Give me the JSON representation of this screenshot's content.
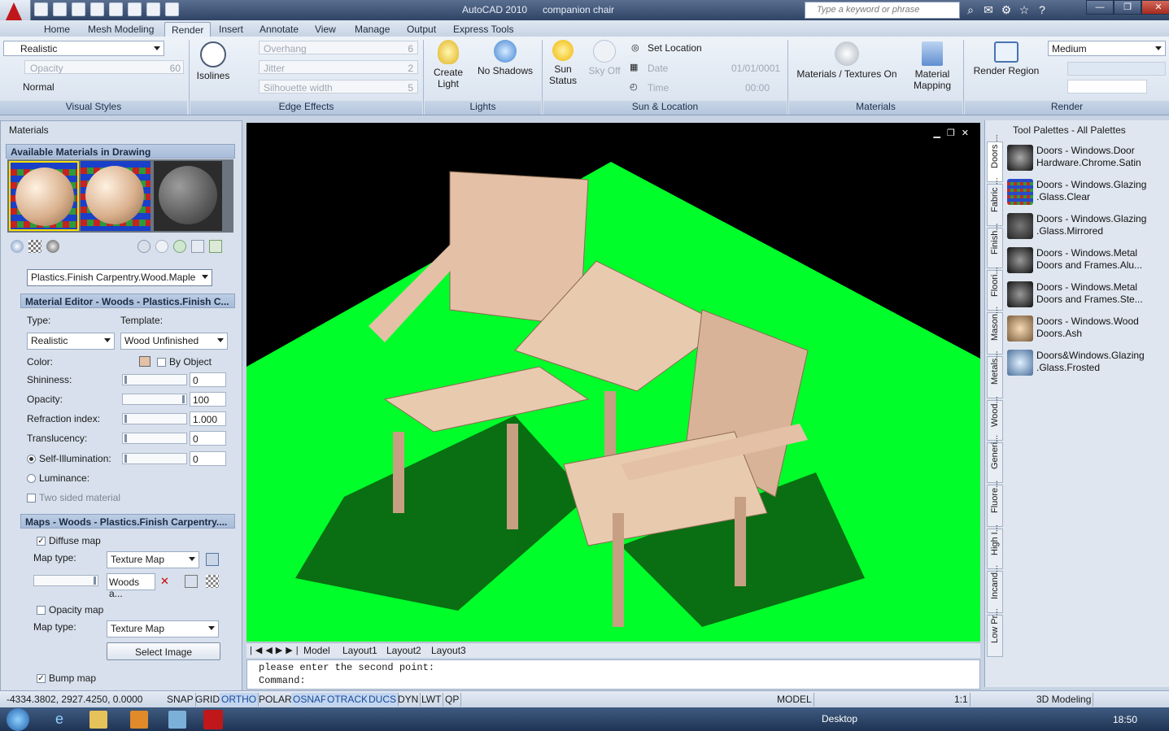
{
  "window": {
    "title": "AutoCAD 2010",
    "document": "companion chair",
    "search_placeholder": "Type a keyword or phrase"
  },
  "ribbon_tabs": [
    "Home",
    "Mesh Modeling",
    "Render",
    "Insert",
    "Annotate",
    "View",
    "Manage",
    "Output",
    "Express Tools"
  ],
  "active_tab": "Render",
  "visual_styles": {
    "style": "Realistic",
    "opacity_label": "Opacity",
    "opacity_value": "60",
    "face_style": "Normal",
    "title": "Visual Styles"
  },
  "edge_effects": {
    "isolines": "Isolines",
    "overhang": "Overhang",
    "overhang_val": "6",
    "jitter": "Jitter",
    "jitter_val": "2",
    "silhouette": "Silhouette width",
    "silhouette_val": "5",
    "title": "Edge Effects"
  },
  "lights": {
    "create_light": "Create",
    "create_light2": "Light",
    "no_shadows": "No Shadows",
    "title": "Lights"
  },
  "sun": {
    "sun_status": "Sun",
    "sun_status2": "Status",
    "sky_off": "Sky Off",
    "set_location": "Set Location",
    "date_label": "Date",
    "date_val": "01/01/0001",
    "time_label": "Time",
    "time_val": "00:00",
    "title": "Sun & Location"
  },
  "materials": {
    "textures": "Materials / Textures On",
    "mapping": "Material",
    "mapping2": "Mapping",
    "title": "Materials"
  },
  "render": {
    "region": "Render Region",
    "quality": "Medium",
    "title": "Render"
  },
  "left_palette": {
    "title": "Materials",
    "available": "Available Materials in Drawing",
    "material_name": "Plastics.Finish Carpentry.Wood.Maple",
    "editor_title": "Material Editor - Woods - Plastics.Finish C...",
    "type_label": "Type:",
    "template_label": "Template:",
    "type_val": "Realistic",
    "template_val": "Wood Unfinished",
    "color_label": "Color:",
    "by_object": "By Object",
    "shininess": "Shininess:",
    "shininess_val": "0",
    "opacity": "Opacity:",
    "opacity_val": "100",
    "refraction": "Refraction index:",
    "refraction_val": "1.000",
    "translucency": "Translucency:",
    "translucency_val": "0",
    "self_illum": "Self-Illumination:",
    "self_illum_val": "0",
    "luminance": "Luminance:",
    "two_sided": "Two sided material",
    "maps_title": "Maps - Woods - Plastics.Finish Carpentry....",
    "diffuse_map": "Diffuse map",
    "map_type": "Map type:",
    "texture_map": "Texture Map",
    "woods_btn": "Woods a...",
    "opacity_map": "Opacity map",
    "select_image": "Select Image",
    "bump_map": "Bump map"
  },
  "tool_palette": {
    "title": "Tool Palettes - All Palettes",
    "tabs": [
      "Doors ...",
      "Fabric ...",
      "Finish...",
      "Floori...",
      "Mason...",
      "Metals...",
      "Wood...",
      "Generi...",
      "Fluore...",
      "High I...",
      "Incand...",
      "Low Pr..."
    ],
    "items": [
      {
        "l1": "Doors - Windows.Door",
        "l2": "Hardware.Chrome.Satin"
      },
      {
        "l1": "Doors - Windows.Glazing",
        "l2": ".Glass.Clear"
      },
      {
        "l1": "Doors - Windows.Glazing",
        "l2": ".Glass.Mirrored"
      },
      {
        "l1": "Doors - Windows.Metal",
        "l2": "Doors and Frames.Alu..."
      },
      {
        "l1": "Doors - Windows.Metal",
        "l2": "Doors and Frames.Ste..."
      },
      {
        "l1": "Doors - Windows.Wood",
        "l2": "Doors.Ash"
      },
      {
        "l1": "Doors&Windows.Glazing",
        "l2": ".Glass.Frosted"
      }
    ]
  },
  "layout_tabs": [
    "Model",
    "Layout1",
    "Layout2",
    "Layout3"
  ],
  "command": {
    "line1": "please enter the second point:",
    "line2": "Command:"
  },
  "status": {
    "coords": "-4334.3802, 2927.4250, 0.0000",
    "toggles": [
      "SNAP",
      "GRID",
      "ORTHO",
      "POLAR",
      "OSNAP",
      "OTRACK",
      "DUCS",
      "DYN",
      "LWT",
      "QP"
    ],
    "model": "MODEL",
    "scale": "1:1",
    "workspace": "3D Modeling"
  },
  "taskbar": {
    "desktop": "Desktop",
    "clock": "18:50"
  },
  "colors": {
    "ground": "#00ff2a",
    "wood": "#e3c0a6",
    "brand": "#c0171a"
  }
}
